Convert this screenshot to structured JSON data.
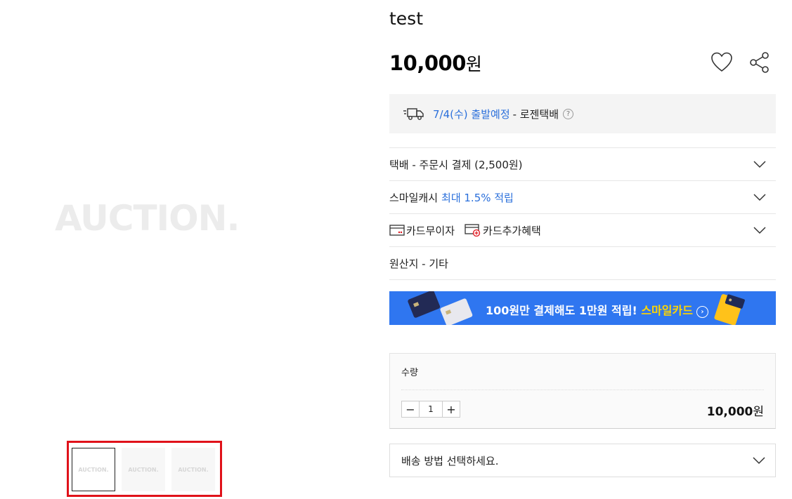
{
  "gallery": {
    "logo_text": "AUCTION.",
    "thumbnails": [
      {
        "label": "AUCTION."
      },
      {
        "label": "AUCTION."
      },
      {
        "label": "AUCTION."
      }
    ]
  },
  "product": {
    "title": "test",
    "price_number": "10,000",
    "price_unit": "원"
  },
  "shipping": {
    "date_text": "7/4(수) 출발예정",
    "courier_text": "- 로젠택배",
    "help_icon": "?"
  },
  "options": {
    "delivery_fee": "택배 - 주문시 결제 (2,500원)",
    "smile_cash_label": "스마일캐시",
    "smile_cash_highlight": "최대 1.5% 적립",
    "card_installment": "카드무이자",
    "card_benefit": "카드추가혜택",
    "origin": "원산지 - 기타"
  },
  "banner": {
    "text": "100원만 결제해도 1만원 적립!",
    "highlight": "스마일카드",
    "arrow": "›"
  },
  "quantity": {
    "label": "수량",
    "minus": "−",
    "value": "1",
    "plus": "+",
    "total_number": "10,000",
    "total_unit": "원"
  },
  "delivery_method": {
    "placeholder": "배송 방법 선택하세요."
  },
  "colors": {
    "accent_blue": "#2a6fdb",
    "banner_blue": "#2f76f0",
    "banner_highlight": "#ffd500",
    "highlight_frame": "#e0121a"
  }
}
